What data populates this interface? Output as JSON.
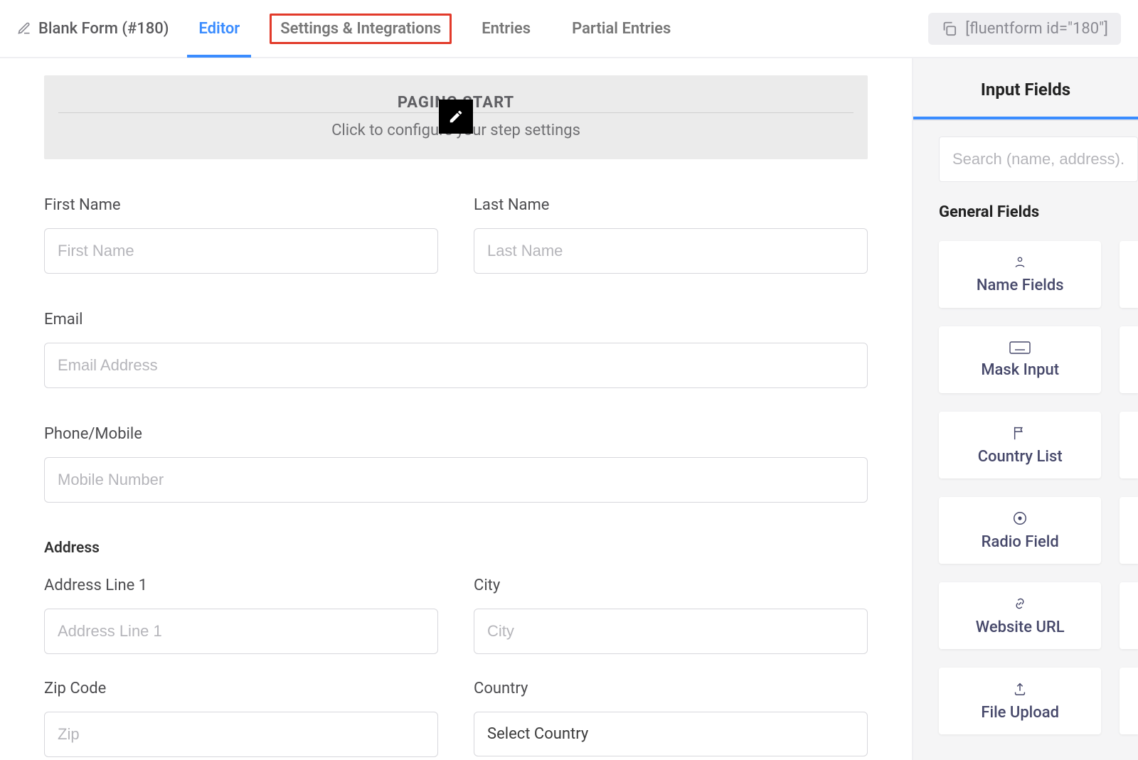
{
  "header": {
    "form_name": "Blank Form (#180)",
    "tabs": {
      "editor": "Editor",
      "settings": "Settings & Integrations",
      "entries": "Entries",
      "partial": "Partial Entries"
    },
    "shortcode": "[fluentform id=\"180\"]"
  },
  "paging": {
    "title": "PAGING START",
    "subtitle": "Click to configure your step settings"
  },
  "form": {
    "first_name": {
      "label": "First Name",
      "placeholder": "First Name"
    },
    "last_name": {
      "label": "Last Name",
      "placeholder": "Last Name"
    },
    "email": {
      "label": "Email",
      "placeholder": "Email Address"
    },
    "phone": {
      "label": "Phone/Mobile",
      "placeholder": "Mobile Number"
    },
    "address_section": "Address",
    "address1": {
      "label": "Address Line 1",
      "placeholder": "Address Line 1"
    },
    "city": {
      "label": "City",
      "placeholder": "City"
    },
    "zip": {
      "label": "Zip Code",
      "placeholder": "Zip"
    },
    "country": {
      "label": "Country",
      "selected": "Select Country"
    }
  },
  "sidebar": {
    "tab": "Input Fields",
    "search_placeholder": "Search (name, address)...",
    "section": "General Fields",
    "cards": {
      "name": "Name Fields",
      "mask": "Mask Input",
      "country": "Country List",
      "radio": "Radio Field",
      "website": "Website URL",
      "file": "File Upload"
    }
  }
}
